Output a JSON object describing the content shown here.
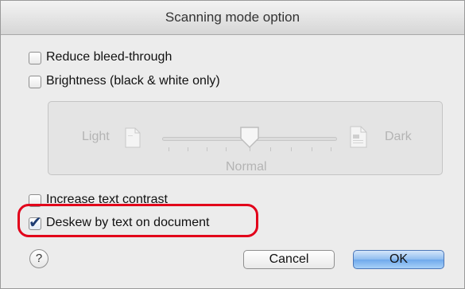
{
  "dialog": {
    "title": "Scanning mode option"
  },
  "options": {
    "reduce_bleed": {
      "label": "Reduce bleed-through",
      "checked": false
    },
    "brightness": {
      "label": "Brightness (black & white only)",
      "checked": false
    },
    "increase_contrast": {
      "label": "Increase text contrast",
      "checked": false
    },
    "deskew": {
      "label": "Deskew by text on document",
      "checked": true
    }
  },
  "brightness_slider": {
    "min_label": "Light",
    "max_label": "Dark",
    "value_label": "Normal",
    "enabled": false,
    "position_fraction": 0.5
  },
  "buttons": {
    "help": "?",
    "cancel": "Cancel",
    "ok": "OK"
  },
  "colors": {
    "highlight": "#e2001a",
    "ok_button": "#8fbdf0"
  }
}
